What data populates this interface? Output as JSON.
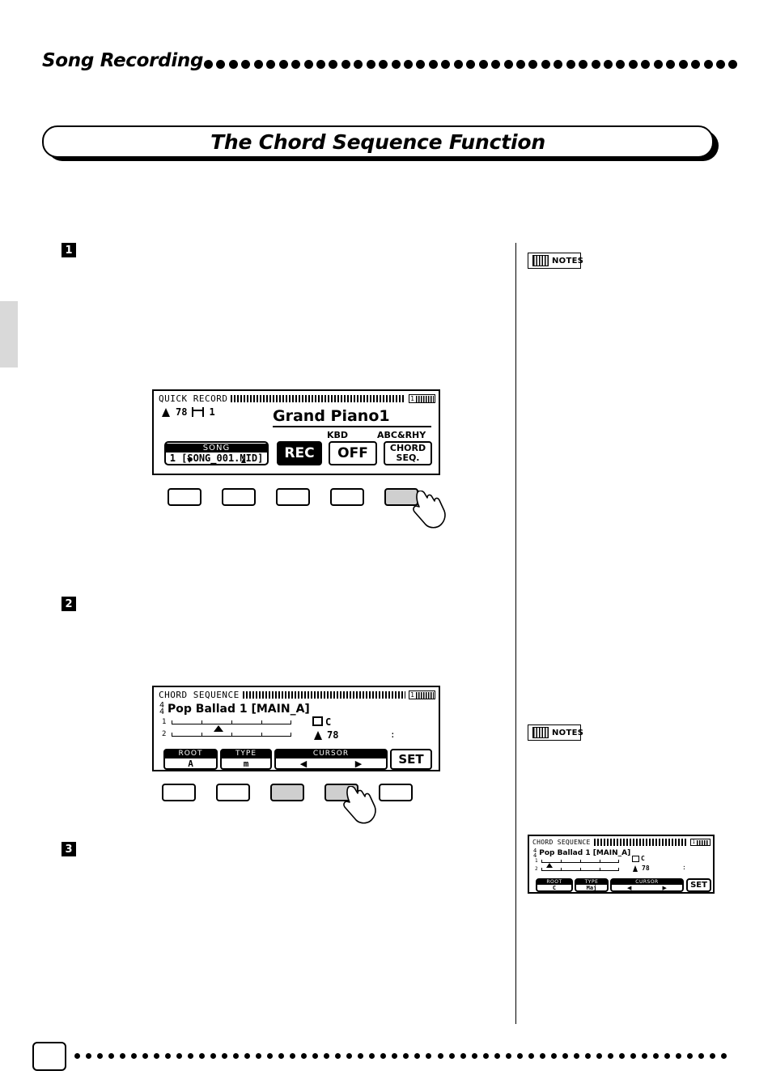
{
  "header": {
    "title": "Song Recording",
    "dot_count": 43
  },
  "banner": {
    "title": "The Chord Sequence Function"
  },
  "steps": {
    "one": "1",
    "two": "2",
    "three": "3"
  },
  "notes": {
    "label": "NOTES",
    "icon": "keyboard-icon"
  },
  "quick_record_lcd": {
    "title": "QUICK RECORD",
    "page_chip": "1",
    "tempo": "78",
    "measure": "1",
    "voice": "Grand Piano1",
    "kbd_label": "KBD",
    "abc_label": "ABC&RHY",
    "song_header": "SONG",
    "song_value": "1 [SONG_001.MID]",
    "arrow_down": "▼",
    "arrow_up": "▲",
    "rec_label": "REC",
    "off_label": "OFF",
    "chord_label_1": "CHORD",
    "chord_label_2": "SEQ."
  },
  "chord_sequence_lcd": {
    "title": "CHORD SEQUENCE",
    "page_chip": "1",
    "time_sig_top": "4",
    "time_sig_bottom": "4",
    "style_name": "Pop Ballad 1 [MAIN_A]",
    "row1_label": "1",
    "row2_label": "2",
    "chord_name": "C",
    "tempo": "78",
    "beat_mark": ":",
    "root_header": "ROOT",
    "root_value": "A",
    "type_header": "TYPE",
    "type_value": "m",
    "cursor_header": "CURSOR",
    "cursor_left": "◀",
    "cursor_right": "▶",
    "set_label": "SET"
  },
  "chord_sequence_lcd_small": {
    "title": "CHORD SEQUENCE",
    "page_chip": "1",
    "time_sig_top": "4",
    "time_sig_bottom": "4",
    "style_name": "Pop Ballad 1 [MAIN_A]",
    "row1_label": "1",
    "row2_label": "2",
    "chord_name": "C",
    "tempo": "78",
    "beat_mark": ":",
    "root_header": "ROOT",
    "root_value": "C",
    "type_header": "TYPE",
    "type_value": "Maj",
    "cursor_header": "CURSOR",
    "cursor_left": "◀",
    "cursor_right": "▶",
    "set_label": "SET"
  },
  "hardware_buttons": {
    "row1_count": 5,
    "row1_pressed_index": 4,
    "row2_count": 5,
    "row2_pressed_indices": [
      2,
      3
    ]
  },
  "footer": {
    "dot_count": 58
  }
}
